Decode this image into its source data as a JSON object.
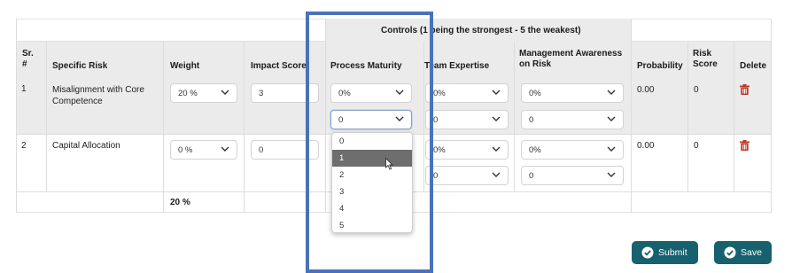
{
  "table": {
    "controls_group_header": "Controls (1 being the strongest - 5 the weakest)",
    "columns": {
      "sr_line1": "Sr.",
      "sr_line2": "#",
      "specific_risk": "Specific Risk",
      "weight": "Weight",
      "impact_score": "Impact Score",
      "process_maturity": "Process Maturity",
      "team_expertise": "Team Expertise",
      "mgmt_awareness_line1": "Management Awareness",
      "mgmt_awareness_line2": "on Risk",
      "probability": "Probability",
      "risk_score_line1": "Risk",
      "risk_score_line2": "Score",
      "delete": "Delete"
    },
    "rows": [
      {
        "sr": "1",
        "risk_line1": "Misalignment with Core",
        "risk_line2": "Competence",
        "weight": "20 %",
        "impact": "3",
        "process_maturity_a": "0%",
        "process_maturity_b": "0",
        "team_expertise_a": "0%",
        "team_expertise_b": "0",
        "mgmt_awareness_a": "0%",
        "mgmt_awareness_b": "0",
        "probability": "0.00",
        "risk_score": "0"
      },
      {
        "sr": "2",
        "risk_line1": "Capital Allocation",
        "weight": "0 %",
        "impact": "0",
        "team_expertise_a": "0%",
        "team_expertise_b": "0",
        "mgmt_awareness_a": "0%",
        "mgmt_awareness_b": "0",
        "probability": "0.00",
        "risk_score": "0"
      }
    ],
    "footer_weight_total": "20 %"
  },
  "dropdown": {
    "options": [
      "0",
      "1",
      "2",
      "3",
      "4",
      "5"
    ],
    "highlighted": "1"
  },
  "buttons": {
    "submit_label": "Submit",
    "save_label": "Save"
  },
  "colors": {
    "primary_button": "#17616e",
    "delete_icon": "#c0392b",
    "highlight_overlay": "#4a72b8",
    "dropdown_highlight": "#6e6e6e"
  },
  "icons": {
    "chevron": "chevron-down-icon",
    "delete": "trash-icon",
    "button_check": "check-circle-icon",
    "cursor": "mouse-pointer-icon"
  }
}
